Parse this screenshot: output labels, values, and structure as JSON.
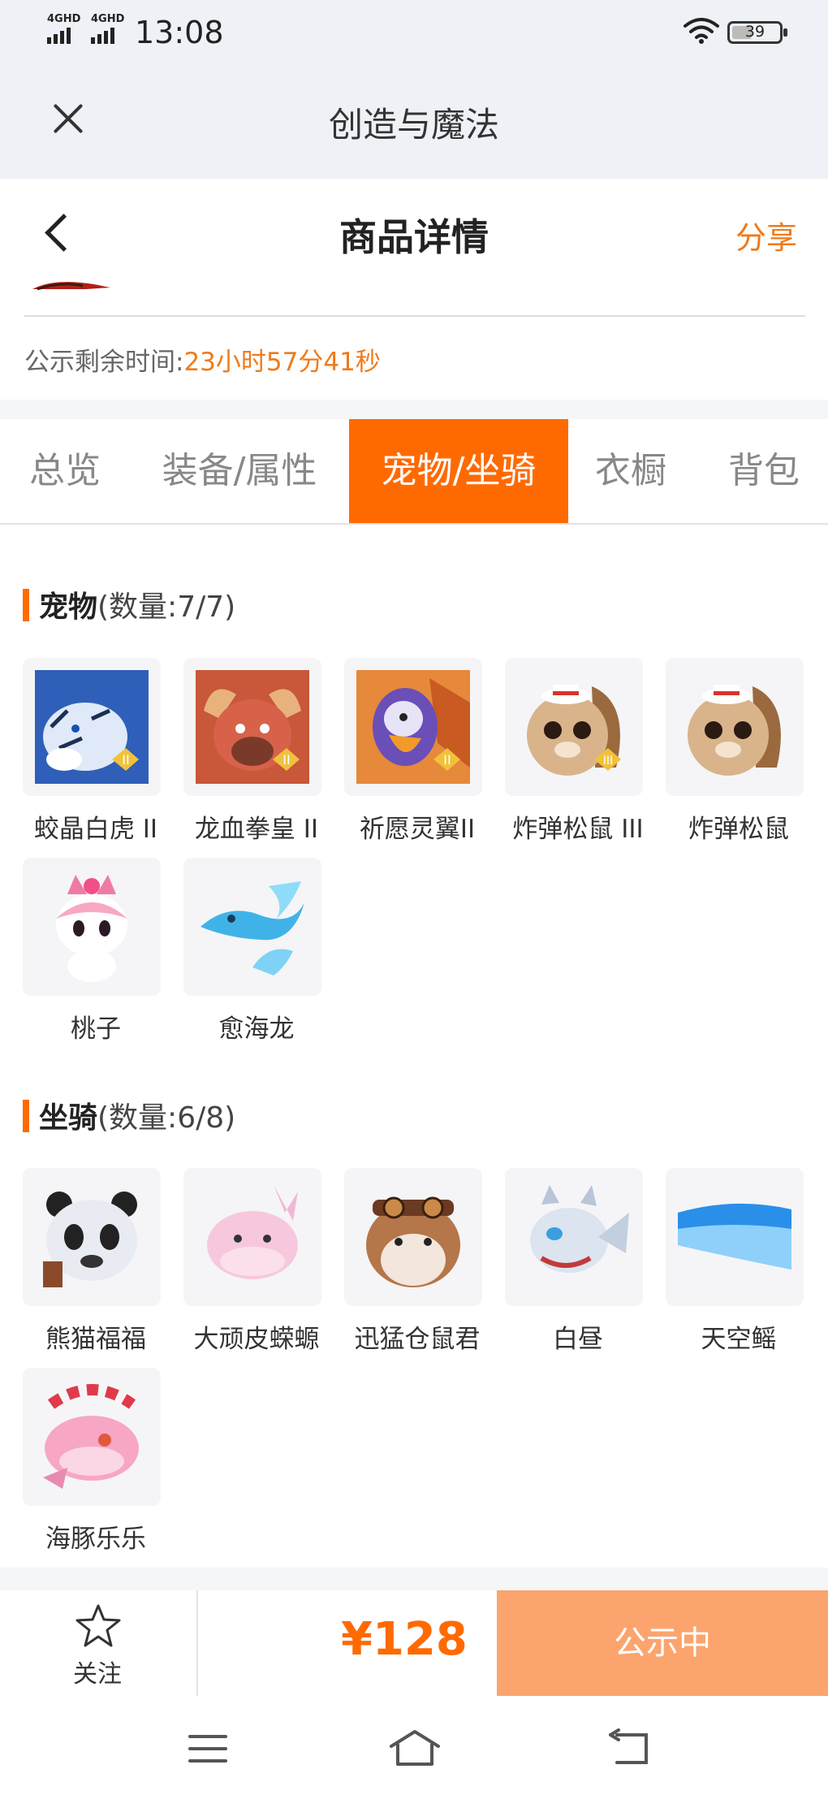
{
  "status_bar": {
    "network_1": "4GHD",
    "network_2": "4GHD",
    "time": "13:08",
    "battery": "39"
  },
  "app_header": {
    "title": "创造与魔法",
    "close_icon": "close-icon"
  },
  "page_header": {
    "title": "商品详情",
    "share": "分享",
    "back_icon": "chevron-left-icon"
  },
  "notice": {
    "label": "公示剩余时间:",
    "value": "23小时57分41秒"
  },
  "tabs": [
    {
      "label": "总览",
      "active": false
    },
    {
      "label": "装备/属性",
      "active": false
    },
    {
      "label": "宠物/坐骑",
      "active": true
    },
    {
      "label": "衣橱",
      "active": false
    },
    {
      "label": "背包",
      "active": false
    }
  ],
  "pets": {
    "title": "宠物",
    "count": "(数量:7/7)",
    "items": [
      {
        "name": "蛟晶白虎 II",
        "badge": "II",
        "icon": "white-tiger-icon"
      },
      {
        "name": "龙血拳皇 II",
        "badge": "II",
        "icon": "dragon-fist-icon"
      },
      {
        "name": "祈愿灵翼II",
        "badge": "II",
        "icon": "spirit-wing-bird-icon"
      },
      {
        "name": "炸弹松鼠 III",
        "badge": "III",
        "icon": "bomb-squirrel-icon"
      },
      {
        "name": "炸弹松鼠",
        "badge": "",
        "icon": "bomb-squirrel-icon"
      },
      {
        "name": "桃子",
        "badge": "",
        "icon": "pink-fox-icon"
      },
      {
        "name": "愈海龙",
        "badge": "",
        "icon": "sea-dragon-icon"
      }
    ]
  },
  "mounts": {
    "title": "坐骑",
    "count": "(数量:6/8)",
    "items": [
      {
        "name": "熊猫福福",
        "icon": "panda-icon"
      },
      {
        "name": "大顽皮蝾螈",
        "icon": "axolotl-icon"
      },
      {
        "name": "迅猛仓鼠君",
        "icon": "hamster-icon"
      },
      {
        "name": "白昼",
        "icon": "white-dragon-icon"
      },
      {
        "name": "天空鳐",
        "icon": "sky-ray-icon"
      },
      {
        "name": "海豚乐乐",
        "icon": "dolphin-icon"
      }
    ]
  },
  "bottom_bar": {
    "follow": "关注",
    "price": "¥128",
    "status_button": "公示中"
  },
  "colors": {
    "accent": "#ff6a00",
    "share": "#f07a1a",
    "status_button": "#fba46e"
  }
}
